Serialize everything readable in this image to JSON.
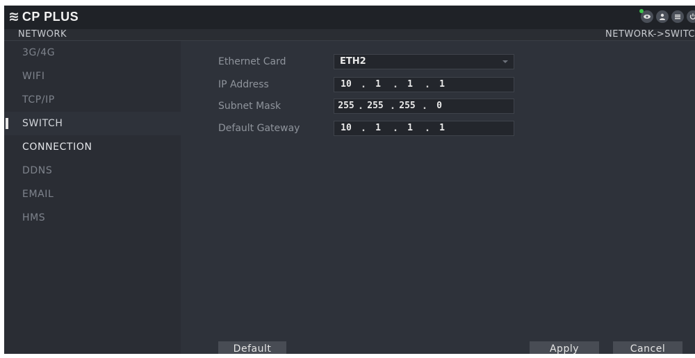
{
  "header": {
    "brand": "CP PLUS",
    "icons": [
      "eye-icon",
      "user-icon",
      "menu-icon",
      "power-icon"
    ],
    "live_indicator_color": "#3ec24d"
  },
  "titlebar": {
    "section": "NETWORK",
    "breadcrumb": "NETWORK->SWITC"
  },
  "sidebar": {
    "items": [
      {
        "label": "3G/4G"
      },
      {
        "label": "WIFI"
      },
      {
        "label": "TCP/IP"
      },
      {
        "label": "SWITCH",
        "active": true
      },
      {
        "label": "CONNECTION"
      },
      {
        "label": "DDNS"
      },
      {
        "label": "EMAIL"
      },
      {
        "label": "HMS"
      }
    ]
  },
  "form": {
    "ethernet_card": {
      "label": "Ethernet Card",
      "value": "ETH2"
    },
    "ip_address": {
      "label": "IP Address",
      "octets": [
        "10",
        "1",
        "1",
        "1"
      ]
    },
    "subnet_mask": {
      "label": "Subnet Mask",
      "octets": [
        "255",
        "255",
        "255",
        "0"
      ]
    },
    "default_gateway": {
      "label": "Default Gateway",
      "octets": [
        "10",
        "1",
        "1",
        "1"
      ]
    }
  },
  "buttons": {
    "default": "Default",
    "apply": "Apply",
    "cancel": "Cancel"
  },
  "colors": {
    "background": "#2e323a",
    "sidebar": "#2a2d34",
    "topbar": "#1f2227",
    "button": "#484c54"
  }
}
